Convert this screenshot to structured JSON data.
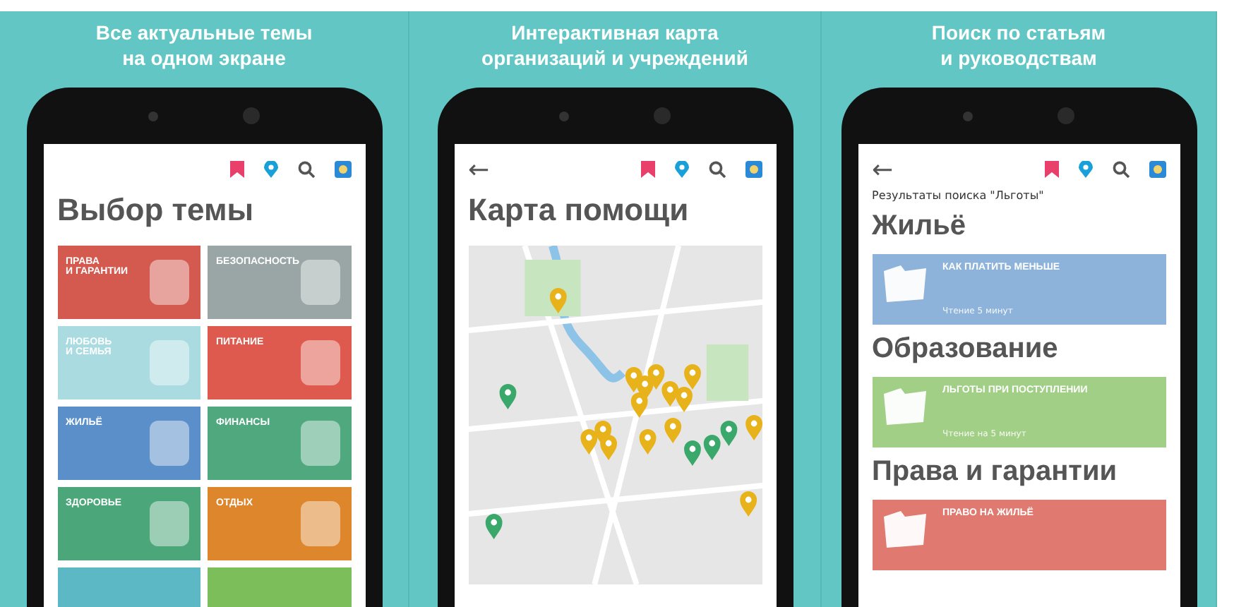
{
  "panels": [
    {
      "kind": "topics",
      "caption": "Все актуальные темы\nна одном экране",
      "screen": {
        "title": "Выбор темы",
        "tiles": [
          {
            "label": "ПРАВА\nИ ГАРАНТИИ",
            "color": "#d45a50"
          },
          {
            "label": "БЕЗОПАСНОСТЬ",
            "color": "#9aa6a6"
          },
          {
            "label": "ЛЮБОВЬ\nИ СЕМЬЯ",
            "color": "#a9dbe0"
          },
          {
            "label": "ПИТАНИЕ",
            "color": "#df5a4e"
          },
          {
            "label": "ЖИЛЬЁ",
            "color": "#5a8fca"
          },
          {
            "label": "ФИНАНСЫ",
            "color": "#4fa87e"
          },
          {
            "label": "ЗДОРОВЬЕ",
            "color": "#4ba67a"
          },
          {
            "label": "ОТДЫХ",
            "color": "#de862c"
          },
          {
            "color": "#5bb8c4"
          },
          {
            "color": "#7cbf5a"
          }
        ]
      }
    },
    {
      "kind": "map",
      "caption": "Интерактивная карта\nорганизаций и учреждений",
      "screen": {
        "back": "←",
        "title": "Карта помощи"
      }
    },
    {
      "kind": "search",
      "caption": "Поиск по статьям\nи руководствам",
      "screen": {
        "back": "←",
        "query_label": "Результаты поиска \"Льготы\"",
        "groups": [
          {
            "heading": "Жильё",
            "card": {
              "title": "КАК ПЛАТИТЬ МЕНЬШЕ",
              "subtitle": "Чтение 5 минут",
              "color": "#8db3da"
            }
          },
          {
            "heading": "Образование",
            "card": {
              "title": "ЛЬГОТЫ ПРИ ПОСТУПЛЕНИИ",
              "subtitle": "Чтение на 5 минут",
              "color": "#a2cf86"
            }
          },
          {
            "heading": "Права и гарантии",
            "card": {
              "title": "ПРАВО НА ЖИЛЬЁ",
              "color": "#e07a70"
            }
          }
        ]
      }
    }
  ]
}
